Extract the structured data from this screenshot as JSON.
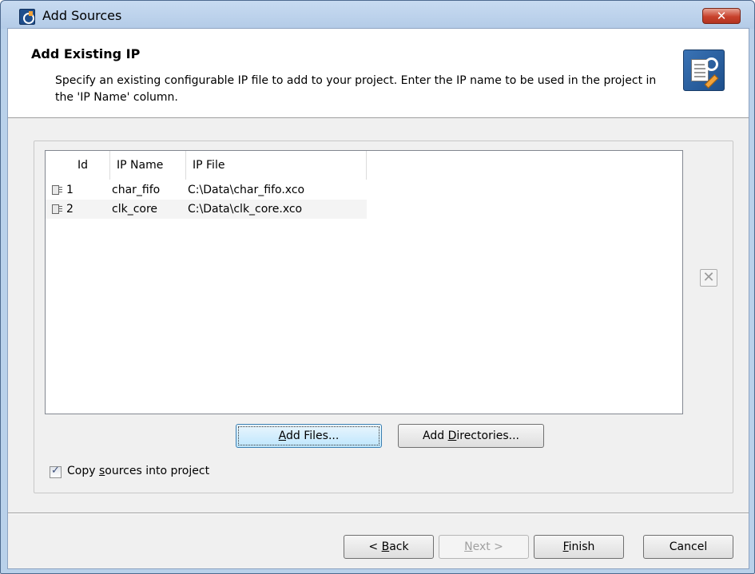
{
  "window": {
    "title": "Add Sources",
    "close_label": "✕"
  },
  "header": {
    "title": "Add Existing IP",
    "description": "Specify an existing configurable IP file to add to your project. Enter the IP name to be used in the project in the 'IP Name' column."
  },
  "table": {
    "columns": [
      "Id",
      "IP Name",
      "IP File"
    ],
    "rows": [
      {
        "id": "1",
        "ip_name": "char_fifo",
        "ip_file": "C:\\Data\\char_fifo.xco"
      },
      {
        "id": "2",
        "ip_name": "clk_core",
        "ip_file": "C:\\Data\\clk_core.xco"
      }
    ]
  },
  "remove_button": {
    "label": "✕"
  },
  "buttons": {
    "add_files": {
      "prefix": "",
      "mnemonic": "A",
      "rest": "dd Files..."
    },
    "add_directories": {
      "prefix": "Add ",
      "mnemonic": "D",
      "rest": "irectories..."
    }
  },
  "copy_sources": {
    "checked": true,
    "check_glyph": "✓",
    "prefix": "Copy ",
    "mnemonic": "s",
    "rest": "ources into project"
  },
  "footer": {
    "back": {
      "prefix": "< ",
      "mnemonic": "B",
      "rest": "ack"
    },
    "next": {
      "prefix": "",
      "mnemonic": "N",
      "rest": "ext >",
      "disabled": true
    },
    "finish": {
      "prefix": "",
      "mnemonic": "F",
      "rest": "inish"
    },
    "cancel": {
      "label": "Cancel"
    }
  }
}
